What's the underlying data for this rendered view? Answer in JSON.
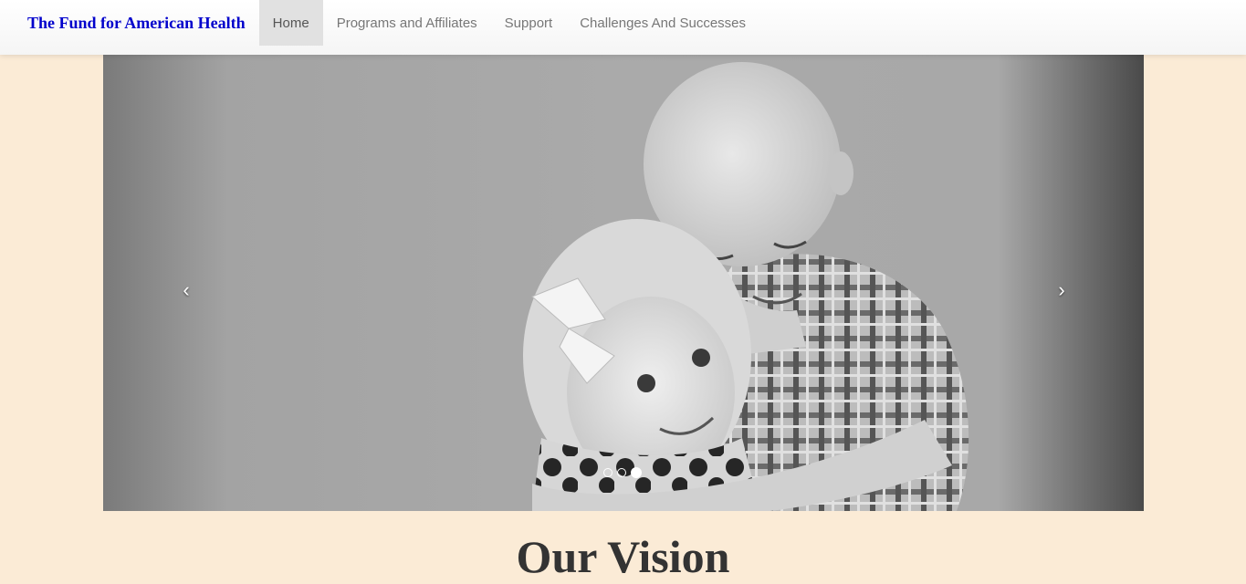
{
  "navbar": {
    "brand": "The Fund for American Health",
    "brand_color": "#0000cc",
    "items": [
      {
        "label": "Home",
        "active": true
      },
      {
        "label": "Programs and Affiliates",
        "active": false
      },
      {
        "label": "Support",
        "active": false
      },
      {
        "label": "Challenges And Successes",
        "active": false
      }
    ]
  },
  "carousel": {
    "prev_icon": "chevron-left-icon",
    "next_icon": "chevron-right-icon",
    "prev_glyph": "‹",
    "next_glyph": "›",
    "slide_count": 3,
    "active_slide": 3,
    "image": "black-and-white photo of a bald boy hugging a smiling little girl with a white hair bow"
  },
  "main": {
    "heading": "Our Vision"
  },
  "colors": {
    "page_background": "#fbebd6",
    "heading": "#333333",
    "nav_text": "#777777",
    "nav_active_bg": "#e1e1e1"
  }
}
